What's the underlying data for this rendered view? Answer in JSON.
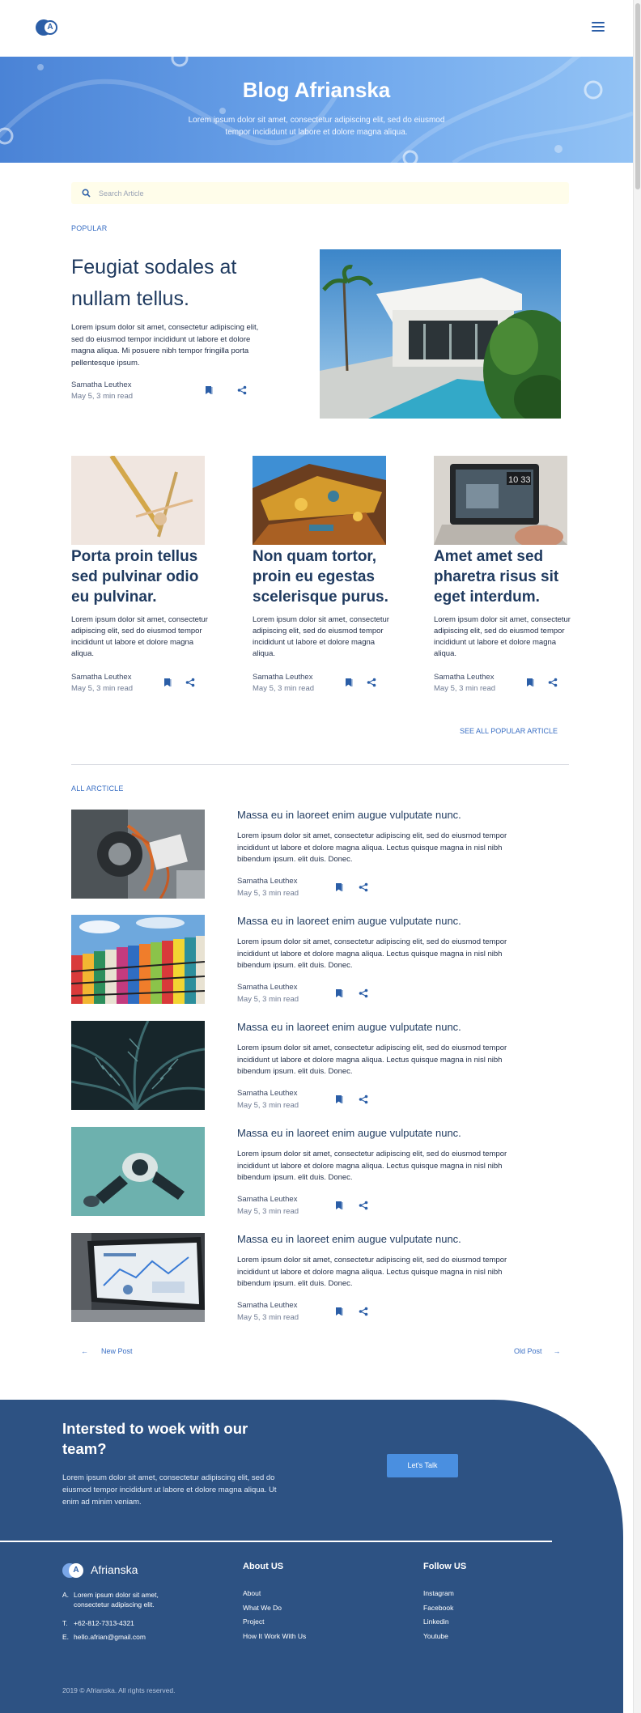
{
  "header": {
    "logo_letter": "A",
    "menu_icon": "hamburger-menu-icon"
  },
  "hero": {
    "title": "Blog Afrianska",
    "subtitle": "Lorem ipsum dolor sit amet, consectetur adipiscing elit, sed do eiusmod tempor incididunt ut labore et dolore magna aliqua."
  },
  "search": {
    "placeholder": "Search Article",
    "value": ""
  },
  "popular": {
    "label": "POPULAR",
    "featured": {
      "title": "Feugiat sodales at nullam tellus.",
      "text": "Lorem ipsum dolor sit amet, consectetur adipiscing elit, sed do eiusmod tempor incididunt ut labore et dolore magna aliqua. Mi posuere nibh tempor fringilla porta pellentesque ipsum.",
      "author": "Samatha Leuthex",
      "date": "May 5, 3 min read"
    },
    "cards": [
      {
        "title": "Porta proin tellus sed pulvinar odio eu pulvinar.",
        "text": "Lorem ipsum dolor sit amet, consectetur adipiscing elit, sed do eiusmod tempor incididunt ut labore et dolore magna aliqua.",
        "author": "Samatha Leuthex",
        "date": "May 5, 3 min read"
      },
      {
        "title": "Non quam tortor, proin eu egestas scelerisque purus.",
        "text": "Lorem ipsum dolor sit amet, consectetur adipiscing elit, sed do eiusmod tempor incididunt ut labore et dolore magna aliqua.",
        "author": "Samatha Leuthex",
        "date": "May 5, 3 min read"
      },
      {
        "title": "Amet amet sed pharetra risus sit eget interdum.",
        "text": "Lorem ipsum dolor sit amet, consectetur adipiscing elit, sed do eiusmod tempor incididunt ut labore et dolore magna aliqua.",
        "author": "Samatha Leuthex",
        "date": "May 5, 3 min read"
      }
    ],
    "see_all": "SEE ALL POPULAR ARTICLE"
  },
  "all_articles": {
    "label": "ALL ARCTICLE",
    "items": [
      {
        "title": "Massa eu in laoreet enim augue vulputate nunc.",
        "text": "Lorem ipsum dolor sit amet, consectetur adipiscing elit, sed do eiusmod tempor incididunt ut labore et dolore magna aliqua. Lectus quisque magna in nisl nibh bibendum ipsum. elit duis. Donec.",
        "author": "Samatha Leuthex",
        "date": "May 5, 3 min read"
      },
      {
        "title": "Massa eu in laoreet enim augue vulputate nunc.",
        "text": "Lorem ipsum dolor sit amet, consectetur adipiscing elit, sed do eiusmod tempor incididunt ut labore et dolore magna aliqua. Lectus quisque magna in nisl nibh bibendum ipsum. elit duis. Donec.",
        "author": "Samatha Leuthex",
        "date": "May 5, 3 min read"
      },
      {
        "title": "Massa eu in laoreet enim augue vulputate nunc.",
        "text": "Lorem ipsum dolor sit amet, consectetur adipiscing elit, sed do eiusmod tempor incididunt ut labore et dolore magna aliqua. Lectus quisque magna in nisl nibh bibendum ipsum. elit duis. Donec.",
        "author": "Samatha Leuthex",
        "date": "May 5, 3 min read"
      },
      {
        "title": "Massa eu in laoreet enim augue vulputate nunc.",
        "text": "Lorem ipsum dolor sit amet, consectetur adipiscing elit, sed do eiusmod tempor incididunt ut labore et dolore magna aliqua. Lectus quisque magna in nisl nibh bibendum ipsum. elit duis. Donec.",
        "author": "Samatha Leuthex",
        "date": "May 5, 3 min read"
      },
      {
        "title": "Massa eu in laoreet enim augue vulputate nunc.",
        "text": "Lorem ipsum dolor sit amet, consectetur adipiscing elit, sed do eiusmod tempor incididunt ut labore et dolore magna aliqua. Lectus quisque magna in nisl nibh bibendum ipsum. elit duis. Donec.",
        "author": "Samatha Leuthex",
        "date": "May 5, 3 min read"
      }
    ]
  },
  "pagination": {
    "prev_label": "New Post",
    "next_label": "Old Post"
  },
  "cta": {
    "title": "Intersted to woek with our team?",
    "text": "Lorem ipsum dolor sit amet, consectetur adipiscing elit, sed do eiusmod tempor incididunt ut labore et dolore magna aliqua. Ut enim ad minim veniam.",
    "button": "Let's Talk"
  },
  "footer": {
    "brand": "Afrianska",
    "logo_letter": "A",
    "contact": [
      {
        "key": "A.",
        "value": "Lorem ipsum dolor sit amet, consectetur adipiscing elit."
      },
      {
        "key": "T.",
        "value": "+62-812-7313-4321"
      },
      {
        "key": "E.",
        "value": "hello.afrian@gmail.com"
      }
    ],
    "about_heading": "About US",
    "about_links": [
      "About",
      "What We Do",
      "Project",
      "How It Work With Us"
    ],
    "follow_heading": "Follow US",
    "follow_links": [
      "Instagram",
      "Facebook",
      "Linkedin",
      "Youtube"
    ],
    "copyright": "2019 © Afrianska. All rights reserved."
  },
  "colors": {
    "primary": "#2b5ea7",
    "accent": "#3a6fc4",
    "footer_bg": "#2d5283",
    "cta_button": "#4a8fe0",
    "search_bg": "#fffdea"
  }
}
